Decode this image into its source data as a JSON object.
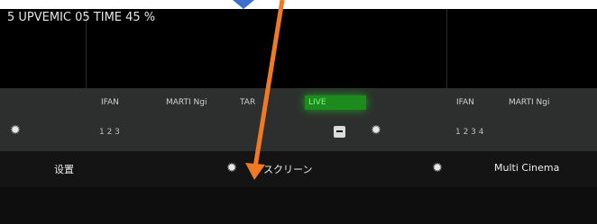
{
  "channels": {
    "left": [
      "IFAN",
      "MARTI Ngi",
      "TAR",
      "LIVE"
    ],
    "right": [
      "IFAN",
      "MARTI Ngi"
    ],
    "left_subrow": "1   2   3",
    "right_subrow": "1   2   3   4"
  },
  "toolbar": {
    "left_label": "设置",
    "center_label": "スクリーン",
    "right_label": "Multi Cinema"
  },
  "status": {
    "text": "5 UPVEMIC 05 TIME 45 %"
  },
  "colors": {
    "active": "#1c8a1c",
    "arrow": "#f07a24",
    "top_chevron": "#3d6fd1"
  }
}
